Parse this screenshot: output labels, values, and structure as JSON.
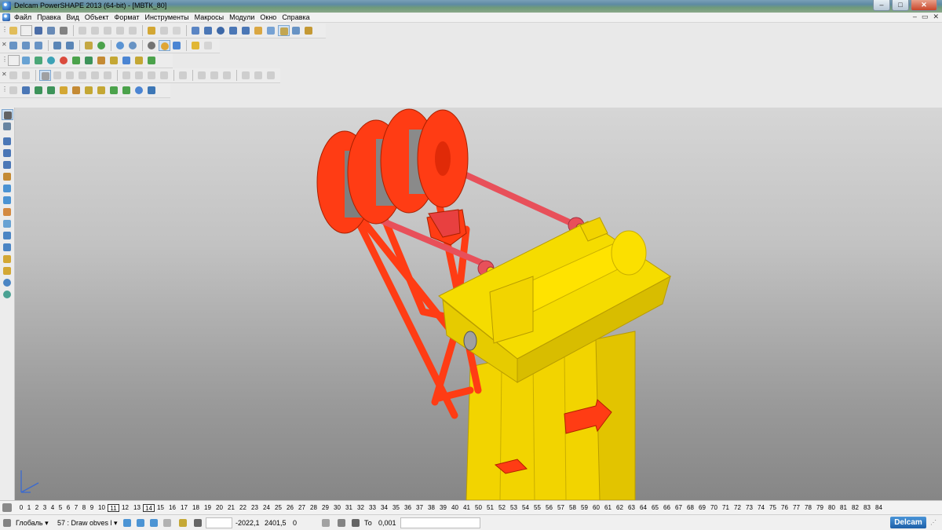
{
  "window": {
    "title": "Delcam PowerSHAPE 2013 (64-bit) - [МВТК_80]",
    "buttons": {
      "minimize": "–",
      "maximize": "□",
      "close": "✕"
    }
  },
  "menu": {
    "items": [
      "Файл",
      "Правка",
      "Вид",
      "Объект",
      "Формат",
      "Инструменты",
      "Макросы",
      "Модули",
      "Окно",
      "Справка"
    ],
    "right_controls": [
      "–",
      "▭",
      "✕"
    ]
  },
  "toolbars": {
    "row1": [
      "open",
      "new",
      "save",
      "save-as",
      "print",
      "cut",
      "copy",
      "paste",
      "delete",
      "select-all",
      "undo",
      "redo",
      "spline",
      "circle",
      "line",
      "arc",
      "curve",
      "point",
      "brush",
      "solid",
      "surface",
      "wireframe",
      "tools"
    ],
    "row2": [
      "view-iso",
      "view-front",
      "view-top",
      "view-3d",
      "zoom-window",
      "zoom-in",
      "zoom-out",
      "pan",
      "rotate",
      "shade",
      "wire",
      "lights",
      "hand"
    ],
    "row3": [
      "page",
      "doc",
      "cube",
      "sphere",
      "cone",
      "prism",
      "solid-a",
      "solid-b",
      "solid-c",
      "solid-d",
      "solid-e"
    ],
    "row4": [
      "sel-a",
      "sel-b",
      "sel-c",
      "sel-d",
      "sel-e",
      "sel-f",
      "sel-g",
      "sel-h",
      "sel-i",
      "sel-j",
      "sel-k",
      "sel-l",
      "sel-m",
      "sel-n",
      "sel-o",
      "sel-p",
      "sel-q"
    ],
    "row5": [
      "t-a",
      "t-b",
      "t-c",
      "t-d",
      "t-e",
      "t-f",
      "t-g",
      "t-h",
      "t-i",
      "t-j",
      "t-k",
      "t-l",
      "t-m"
    ]
  },
  "left_tools": [
    "select",
    "layers",
    "surface-1",
    "surface-2",
    "surface-3",
    "solid-1",
    "solid-2",
    "solid-3",
    "solid-4",
    "solid-5",
    "solid-6",
    "solid-7",
    "solid-8",
    "solid-9",
    "solid-10"
  ],
  "layers": {
    "numbers": [
      "0",
      "1",
      "2",
      "3",
      "4",
      "5",
      "6",
      "7",
      "8",
      "9",
      "10",
      "11",
      "12",
      "13",
      "14",
      "15",
      "16",
      "17",
      "18",
      "19",
      "20",
      "21",
      "22",
      "23",
      "24",
      "25",
      "26",
      "27",
      "28",
      "29",
      "30",
      "31",
      "32",
      "33",
      "34",
      "35",
      "36",
      "37",
      "38",
      "39",
      "40",
      "41",
      "50",
      "51",
      "52",
      "53",
      "54",
      "55",
      "56",
      "57",
      "58",
      "59",
      "60",
      "61",
      "62",
      "63",
      "64",
      "65",
      "66",
      "67",
      "68",
      "69",
      "70",
      "71",
      "72",
      "73",
      "74",
      "75",
      "76",
      "77",
      "78",
      "79",
      "80",
      "81",
      "82",
      "83",
      "84"
    ],
    "active": [
      "11",
      "14"
    ]
  },
  "status": {
    "workplane": "Глобаль",
    "layer": "57 : Draw obves l",
    "x": "-2022,1",
    "y": "2401,5",
    "z": "0",
    "tolerance_label": "То",
    "tolerance": "0,001",
    "brand": "Delcam"
  },
  "colors": {
    "frame_red": "#ff3c14",
    "rod_pink": "#e8505a",
    "drum_gray": "#8a8a8a",
    "base_yellow": "#f2d400"
  }
}
